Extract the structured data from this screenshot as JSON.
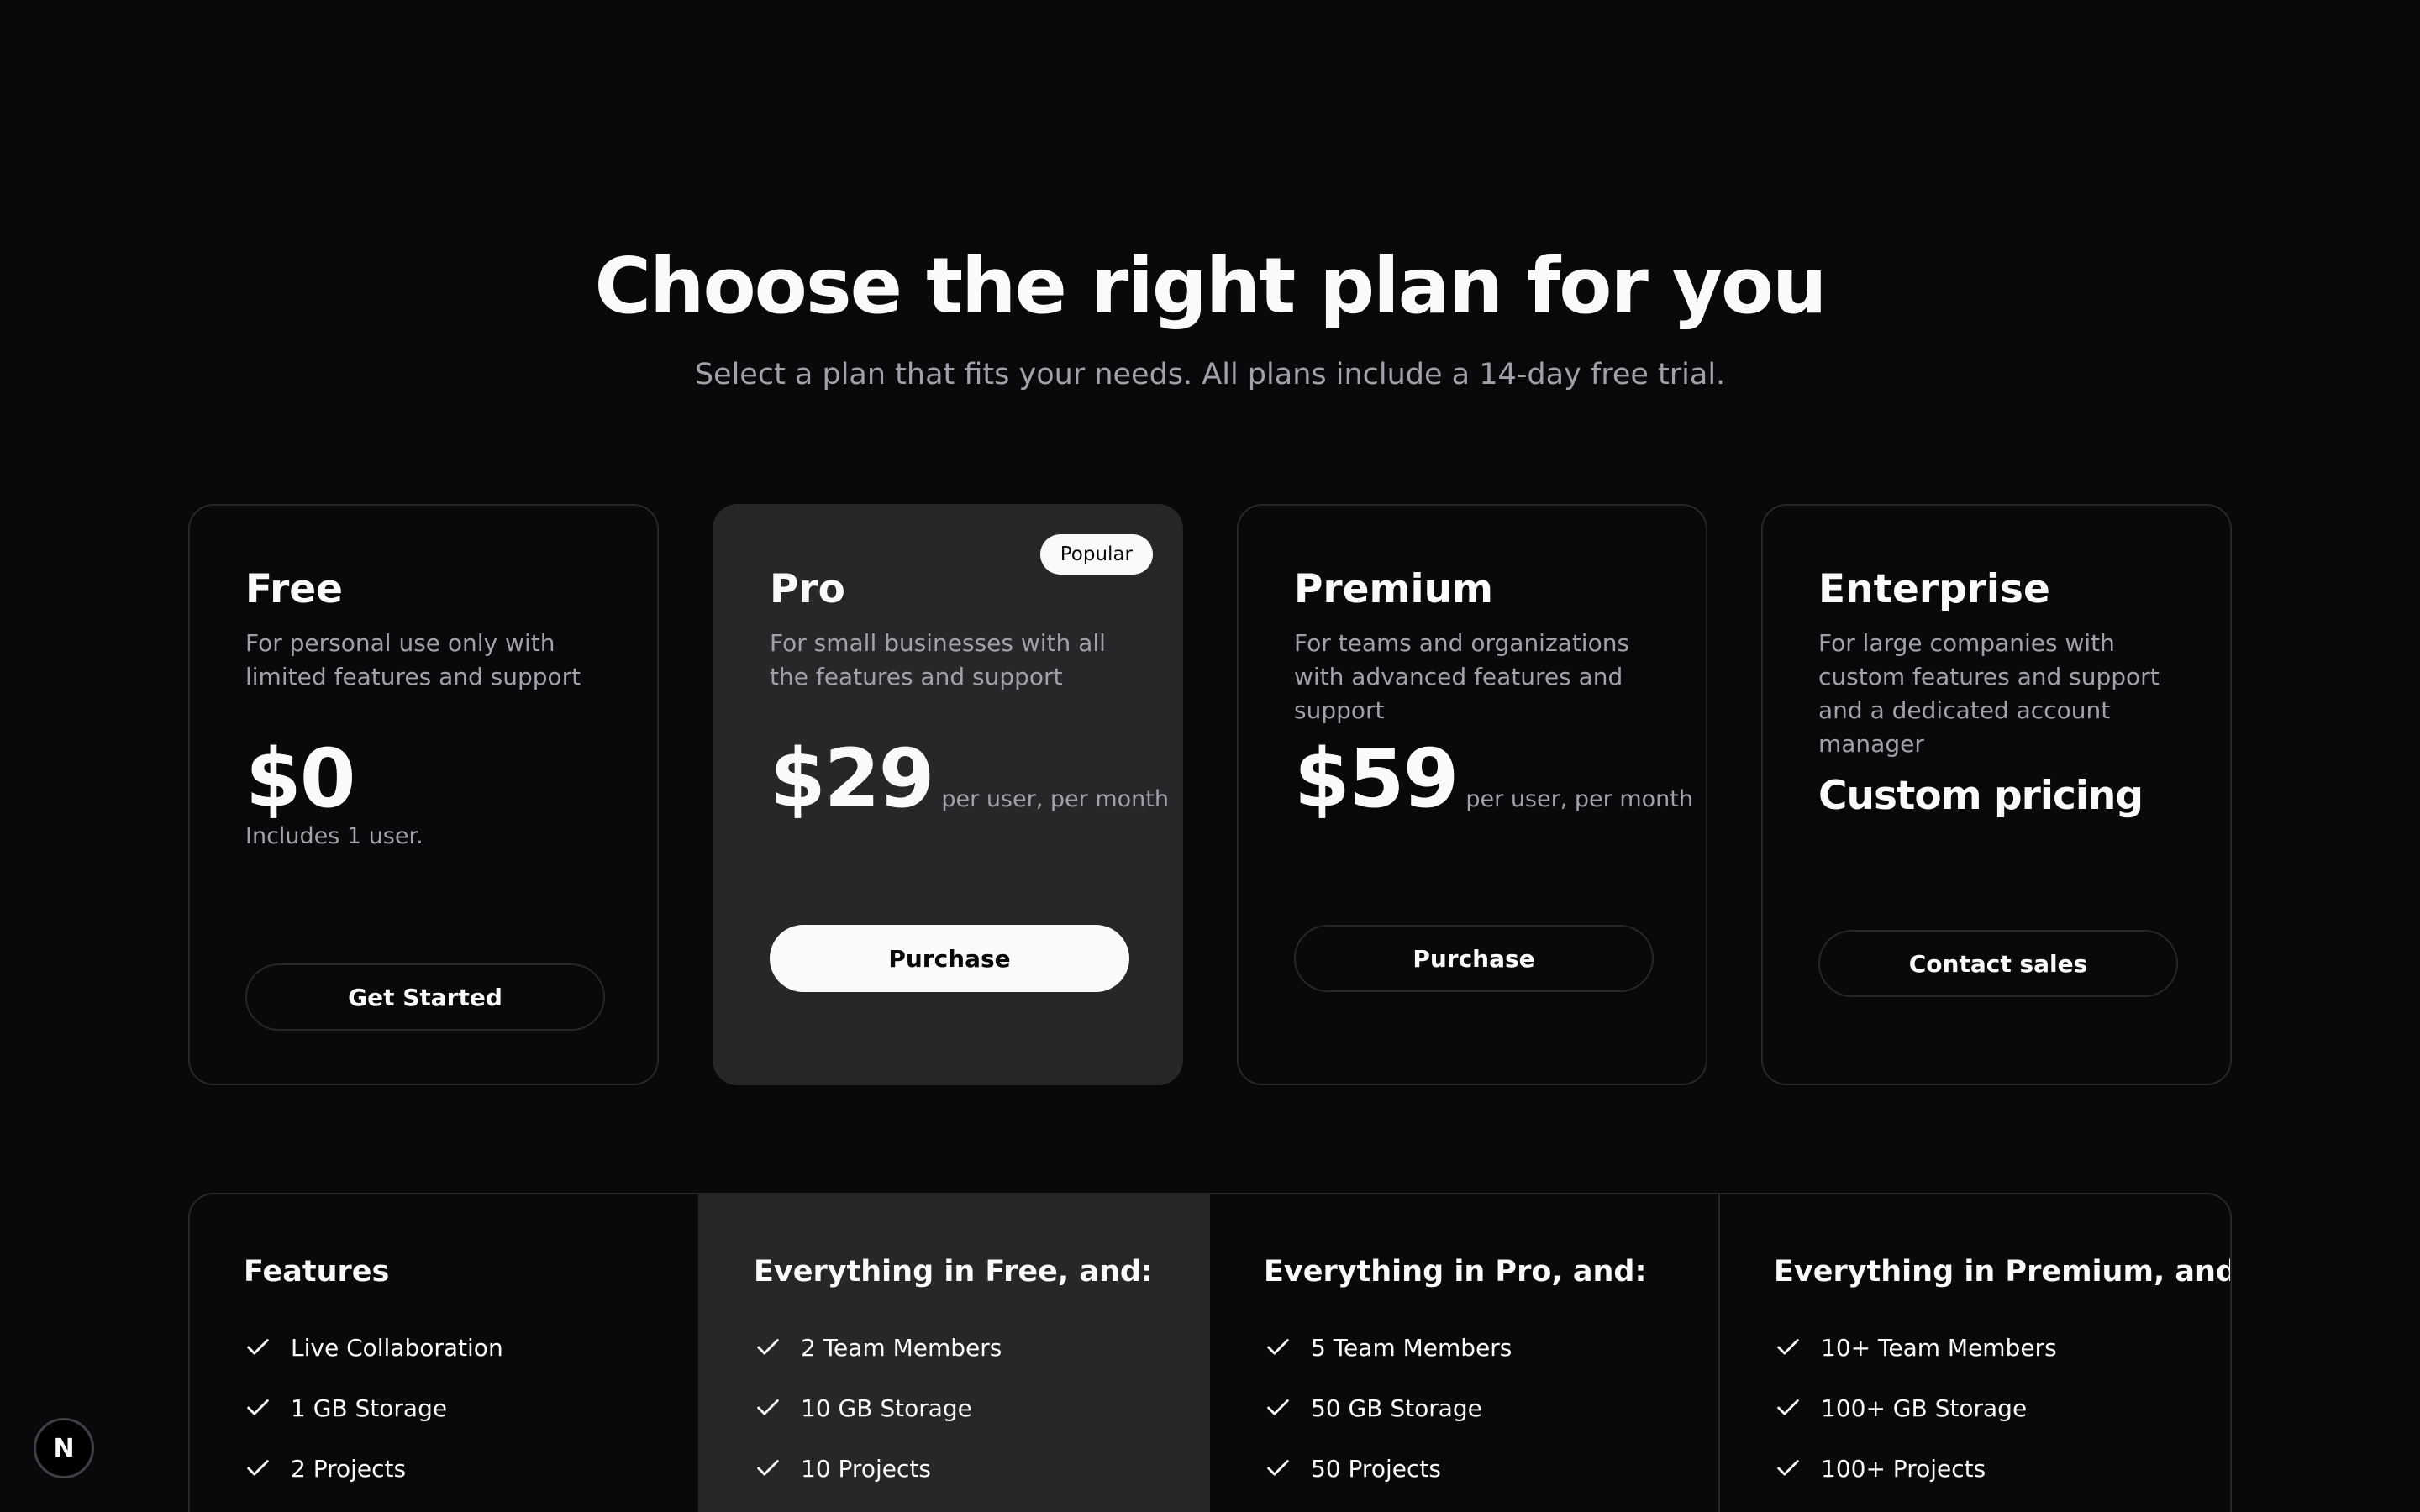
{
  "hero": {
    "title": "Choose the right plan for you",
    "subtitle": "Select a plan that fits your needs. All plans include a 14-day free trial."
  },
  "plans": [
    {
      "name": "Free",
      "description": "For personal use only with limited features and support",
      "price": "$0",
      "price_sub": "Includes 1 user.",
      "button": "Get Started"
    },
    {
      "name": "Pro",
      "badge": "Popular",
      "description": "For small businesses with all the features and support",
      "price": "$29",
      "price_note": "per user, per month",
      "button": "Purchase"
    },
    {
      "name": "Premium",
      "description": "For teams and organizations with advanced features and support",
      "price": "$59",
      "price_note": "per user, per month",
      "button": "Purchase"
    },
    {
      "name": "Enterprise",
      "description": "For large companies with custom features and support and a dedicated account manager",
      "price": "Custom pricing",
      "button": "Contact sales"
    }
  ],
  "features": [
    {
      "title": "Features",
      "items": [
        "Live Collaboration",
        "1 GB Storage",
        "2 Projects"
      ]
    },
    {
      "title": "Everything in Free, and:",
      "items": [
        "2 Team Members",
        "10 GB Storage",
        "10 Projects"
      ]
    },
    {
      "title": "Everything in Pro, and:",
      "items": [
        "5 Team Members",
        "50 GB Storage",
        "50 Projects"
      ]
    },
    {
      "title": "Everything in Premium, and:",
      "items": [
        "10+ Team Members",
        "100+ GB Storage",
        "100+ Projects"
      ]
    }
  ],
  "dev_badge": {
    "label": "N",
    "icon": "nextjs-logo-icon"
  },
  "colors": {
    "background": "#09090b",
    "card_highlight": "#27272a",
    "border": "#27272a",
    "text": "#fafafa",
    "muted": "#a1a1aa"
  }
}
